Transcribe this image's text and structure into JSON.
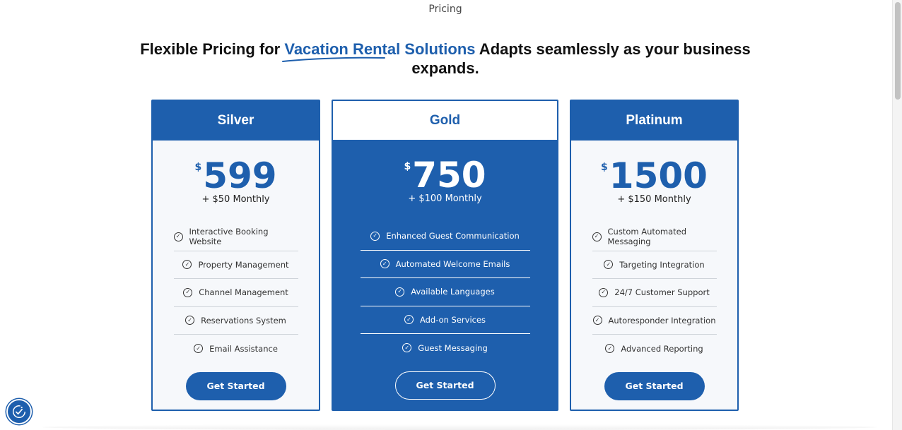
{
  "eyebrow": "Pricing",
  "headline": {
    "prefix": "Flexible Pricing for ",
    "highlight": "Vacation Rental Solutions",
    "suffix": " Adapts seamlessly as your business expands."
  },
  "colors": {
    "brand": "#1e5fad",
    "card_bg": "#f6f8fb"
  },
  "plans": [
    {
      "name": "Silver",
      "currency": "$",
      "price": "599",
      "monthly": "+ $50 Monthly",
      "features": [
        "Interactive Booking Website",
        "Property Management",
        "Channel Management",
        "Reservations System",
        "Email Assistance"
      ],
      "cta": "Get Started"
    },
    {
      "name": "Gold",
      "currency": "$",
      "price": "750",
      "monthly": "+ $100 Monthly",
      "features": [
        "Enhanced Guest Communication",
        "Automated Welcome Emails",
        "Available Languages",
        "Add-on Services",
        "Guest Messaging"
      ],
      "cta": "Get Started"
    },
    {
      "name": "Platinum",
      "currency": "$",
      "price": "1500",
      "monthly": "+ $150 Monthly",
      "features": [
        "Custom Automated Messaging",
        "Targeting Integration",
        "24/7 Customer Support",
        "Autoresponder Integration",
        "Advanced Reporting"
      ],
      "cta": "Get Started"
    }
  ],
  "icons": {
    "feature": "check-circle-icon",
    "accessibility": "accessibility-icon"
  }
}
